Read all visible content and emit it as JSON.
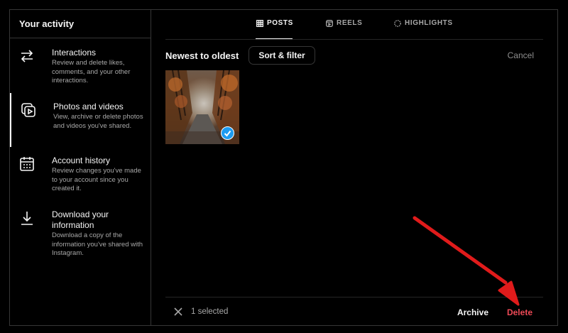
{
  "sidebar": {
    "title": "Your activity",
    "items": [
      {
        "label": "Interactions",
        "description": "Review and delete likes, comments, and your other interactions.",
        "icon": "arrows-swap-icon"
      },
      {
        "label": "Photos and videos",
        "description": "View, archive or delete photos and videos you've shared.",
        "icon": "photos-videos-icon"
      },
      {
        "label": "Account history",
        "description": "Review changes you've made to your account since you created it.",
        "icon": "calendar-icon"
      },
      {
        "label": "Download your information",
        "description": "Download a copy of the information you've shared with Instagram.",
        "icon": "download-icon"
      }
    ]
  },
  "tabs": [
    {
      "label": "POSTS",
      "icon": "grid-icon"
    },
    {
      "label": "REELS",
      "icon": "reels-icon"
    },
    {
      "label": "HIGHLIGHTS",
      "icon": "highlights-icon"
    }
  ],
  "toolbar": {
    "sort_label": "Newest to oldest",
    "sort_button": "Sort & filter",
    "cancel": "Cancel"
  },
  "grid": {
    "items": [
      {
        "alt": "autumn forest path",
        "selected": true
      }
    ]
  },
  "bottom": {
    "selected_text": "1 selected",
    "archive": "Archive",
    "delete": "Delete"
  },
  "colors": {
    "background": "#000000",
    "border": "#363636",
    "check": "#1d9bf0",
    "delete": "#ed4956",
    "annotation_arrow": "#e01b1b"
  }
}
